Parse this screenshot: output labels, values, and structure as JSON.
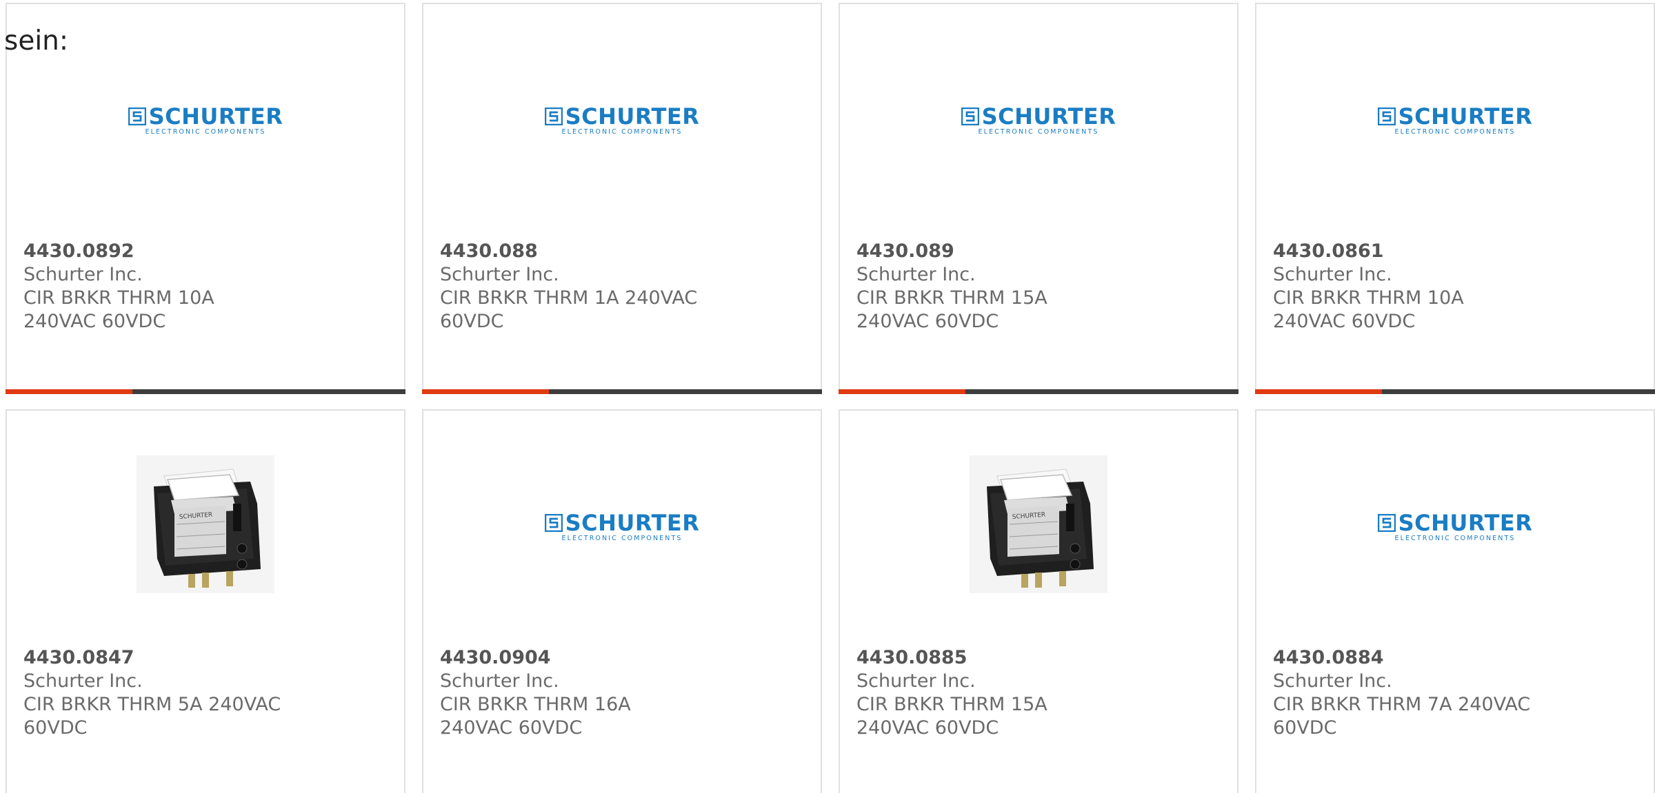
{
  "intro": {
    "text": "sein:"
  },
  "logo": {
    "brand": "SCHURTER",
    "tagline": "ELECTRONIC COMPONENTS"
  },
  "colors": {
    "accent": "#e03a12",
    "bar": "#3d3d3d",
    "brand_blue": "#1a7dc4",
    "text": "#6a6a6a"
  },
  "products": [
    {
      "part": "4430.0892",
      "manufacturer": "Schurter Inc.",
      "description": "CIR BRKR THRM 10A 240VAC 60VDC",
      "image": "schurter-logo"
    },
    {
      "part": "4430.088",
      "manufacturer": "Schurter Inc.",
      "description": "CIR BRKR THRM 1A 240VAC 60VDC",
      "image": "schurter-logo"
    },
    {
      "part": "4430.089",
      "manufacturer": "Schurter Inc.",
      "description": "CIR BRKR THRM 15A 240VAC 60VDC",
      "image": "schurter-logo"
    },
    {
      "part": "4430.0861",
      "manufacturer": "Schurter Inc.",
      "description": "CIR BRKR THRM 10A 240VAC 60VDC",
      "image": "schurter-logo"
    },
    {
      "part": "4430.0847",
      "manufacturer": "Schurter Inc.",
      "description": "CIR BRKR THRM 5A 240VAC 60VDC",
      "image": "rocker-switch-photo"
    },
    {
      "part": "4430.0904",
      "manufacturer": "Schurter Inc.",
      "description": "CIR BRKR THRM 16A 240VAC 60VDC",
      "image": "schurter-logo"
    },
    {
      "part": "4430.0885",
      "manufacturer": "Schurter Inc.",
      "description": "CIR BRKR THRM 15A 240VAC 60VDC",
      "image": "rocker-switch-photo"
    },
    {
      "part": "4430.0884",
      "manufacturer": "Schurter Inc.",
      "description": "CIR BRKR THRM 7A 240VAC 60VDC",
      "image": "schurter-logo"
    }
  ]
}
